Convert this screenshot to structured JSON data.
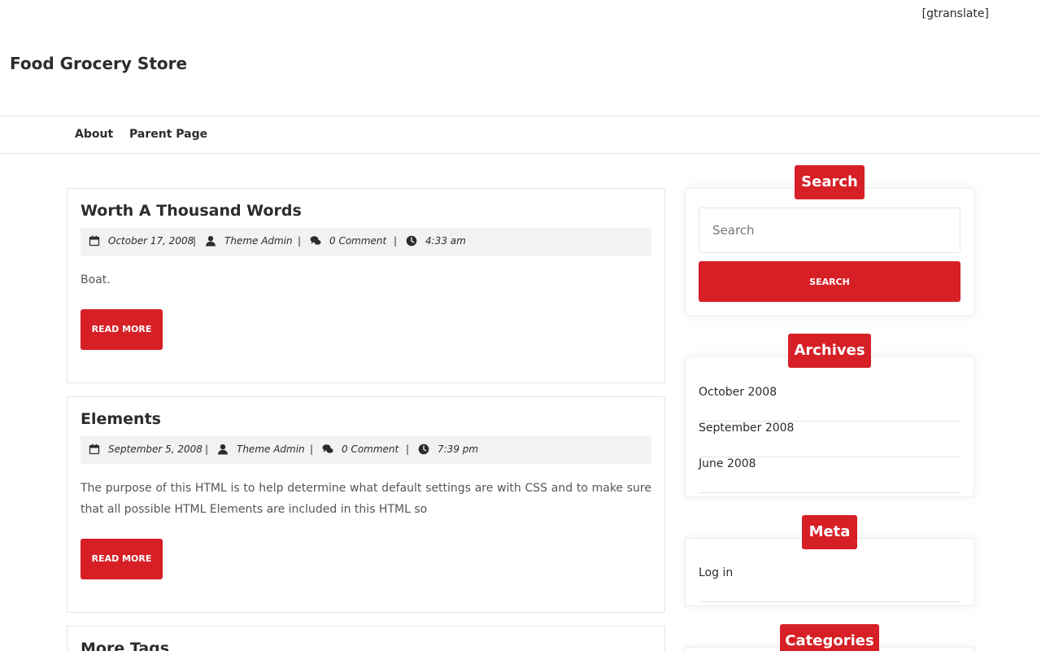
{
  "header": {
    "translate_shortcode": "[gtranslate]",
    "site_title": "Food Grocery Store"
  },
  "nav": {
    "items": [
      {
        "label": "About"
      },
      {
        "label": "Parent Page"
      }
    ]
  },
  "posts": [
    {
      "title": "Worth A Thousand Words",
      "date": "October 17, 2008",
      "author": "Theme Admin",
      "comments": "0 Comment",
      "time": "4:33 am",
      "excerpt": "Boat.",
      "read_more": "READ MORE"
    },
    {
      "title": "Elements",
      "date": "September 5, 2008",
      "author": "Theme Admin",
      "comments": "0 Comment",
      "time": "7:39 pm",
      "excerpt": "The purpose of this HTML is to help determine what default settings are with CSS and to make sure that all possible HTML Elements are included in this HTML so",
      "read_more": "READ MORE"
    },
    {
      "title": "More Tags"
    }
  ],
  "meta_separator": "|",
  "sidebar": {
    "search": {
      "title": "Search",
      "placeholder": "Search",
      "button": "SEARCH"
    },
    "archives": {
      "title": "Archives",
      "items": [
        "October 2008",
        "September 2008",
        "June 2008"
      ]
    },
    "meta": {
      "title": "Meta",
      "items": [
        "Log in"
      ]
    },
    "categories": {
      "title": "Categories"
    }
  },
  "colors": {
    "accent": "#d71f26",
    "text": "#2c2c2c",
    "meta_bg": "#f2f2f2"
  }
}
